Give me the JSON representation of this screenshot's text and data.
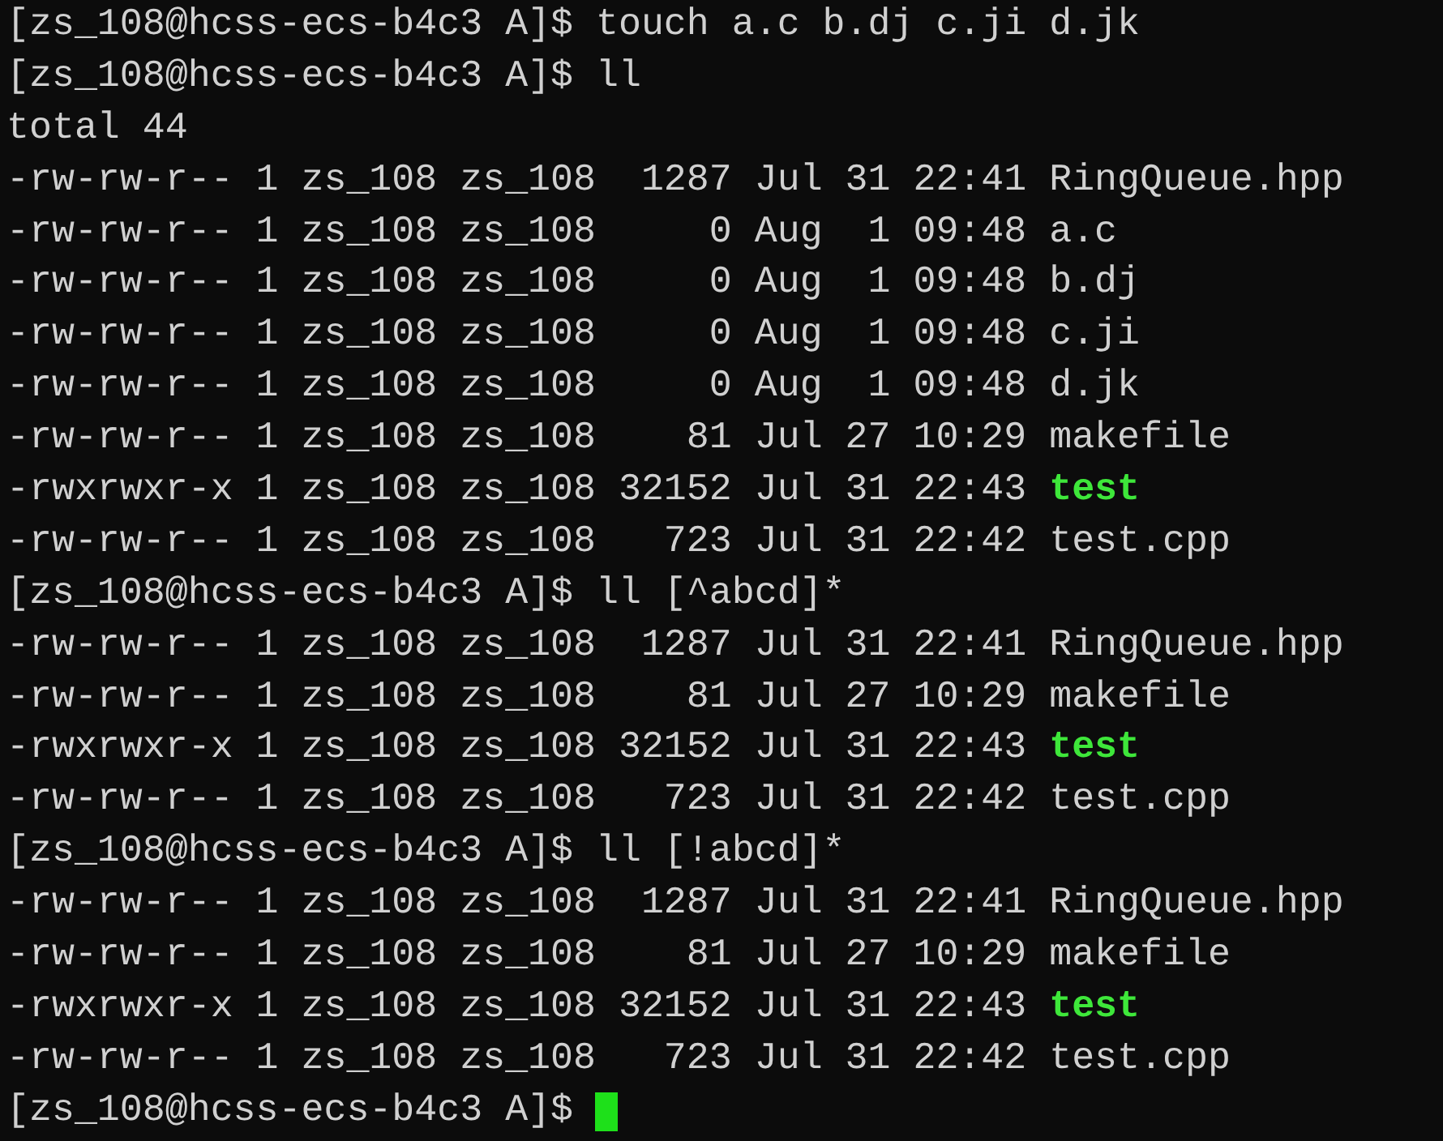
{
  "terminal": {
    "lines": [
      {
        "kind": "prompt",
        "prompt": "[zs_108@hcss-ecs-b4c3 A]$",
        "command": "touch a.c b.dj c.ji d.jk"
      },
      {
        "kind": "prompt",
        "prompt": "[zs_108@hcss-ecs-b4c3 A]$",
        "command": "ll"
      },
      {
        "kind": "text",
        "text": "total 44"
      },
      {
        "kind": "file",
        "info": "-rw-rw-r-- 1 zs_108 zs_108  1287 Jul 31 22:41",
        "name": "RingQueue.hpp",
        "executable": false
      },
      {
        "kind": "file",
        "info": "-rw-rw-r-- 1 zs_108 zs_108     0 Aug  1 09:48",
        "name": "a.c",
        "executable": false
      },
      {
        "kind": "file",
        "info": "-rw-rw-r-- 1 zs_108 zs_108     0 Aug  1 09:48",
        "name": "b.dj",
        "executable": false
      },
      {
        "kind": "file",
        "info": "-rw-rw-r-- 1 zs_108 zs_108     0 Aug  1 09:48",
        "name": "c.ji",
        "executable": false
      },
      {
        "kind": "file",
        "info": "-rw-rw-r-- 1 zs_108 zs_108     0 Aug  1 09:48",
        "name": "d.jk",
        "executable": false
      },
      {
        "kind": "file",
        "info": "-rw-rw-r-- 1 zs_108 zs_108    81 Jul 27 10:29",
        "name": "makefile",
        "executable": false
      },
      {
        "kind": "file",
        "info": "-rwxrwxr-x 1 zs_108 zs_108 32152 Jul 31 22:43",
        "name": "test",
        "executable": true
      },
      {
        "kind": "file",
        "info": "-rw-rw-r-- 1 zs_108 zs_108   723 Jul 31 22:42",
        "name": "test.cpp",
        "executable": false
      },
      {
        "kind": "prompt",
        "prompt": "[zs_108@hcss-ecs-b4c3 A]$",
        "command": "ll [^abcd]*"
      },
      {
        "kind": "file",
        "info": "-rw-rw-r-- 1 zs_108 zs_108  1287 Jul 31 22:41",
        "name": "RingQueue.hpp",
        "executable": false
      },
      {
        "kind": "file",
        "info": "-rw-rw-r-- 1 zs_108 zs_108    81 Jul 27 10:29",
        "name": "makefile",
        "executable": false
      },
      {
        "kind": "file",
        "info": "-rwxrwxr-x 1 zs_108 zs_108 32152 Jul 31 22:43",
        "name": "test",
        "executable": true
      },
      {
        "kind": "file",
        "info": "-rw-rw-r-- 1 zs_108 zs_108   723 Jul 31 22:42",
        "name": "test.cpp",
        "executable": false
      },
      {
        "kind": "prompt",
        "prompt": "[zs_108@hcss-ecs-b4c3 A]$",
        "command": "ll [!abcd]*"
      },
      {
        "kind": "file",
        "info": "-rw-rw-r-- 1 zs_108 zs_108  1287 Jul 31 22:41",
        "name": "RingQueue.hpp",
        "executable": false
      },
      {
        "kind": "file",
        "info": "-rw-rw-r-- 1 zs_108 zs_108    81 Jul 27 10:29",
        "name": "makefile",
        "executable": false
      },
      {
        "kind": "file",
        "info": "-rwxrwxr-x 1 zs_108 zs_108 32152 Jul 31 22:43",
        "name": "test",
        "executable": true
      },
      {
        "kind": "file",
        "info": "-rw-rw-r-- 1 zs_108 zs_108   723 Jul 31 22:42",
        "name": "test.cpp",
        "executable": false
      },
      {
        "kind": "prompt",
        "prompt": "[zs_108@hcss-ecs-b4c3 A]$",
        "cursor": true
      }
    ]
  }
}
